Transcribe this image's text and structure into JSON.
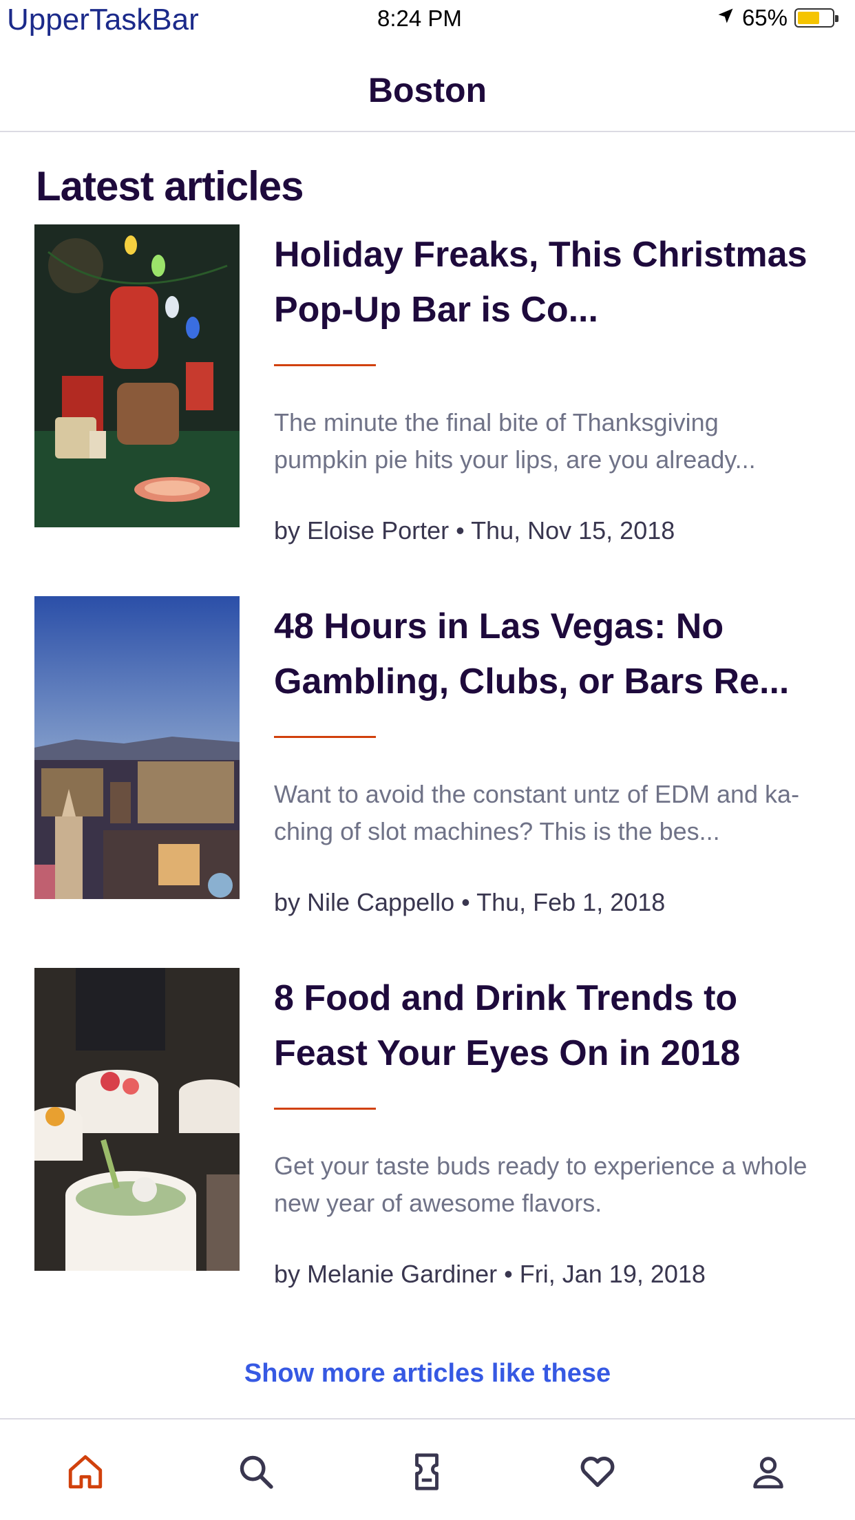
{
  "status_bar": {
    "carrier": "UpperTaskBar",
    "time": "8:24 PM",
    "battery": "65%",
    "battery_level": 0.65,
    "battery_color": "#f5c400"
  },
  "header": {
    "title": "Boston"
  },
  "section": {
    "title": "Latest articles"
  },
  "articles": [
    {
      "title": "Holiday Freaks, This Christmas Pop-Up Bar is Co...",
      "description": "The minute the final bite of Thanksgiving pumpkin pie hits your lips, are you already...",
      "meta": "by Eloise Porter • Thu, Nov 15, 2018",
      "image": "christmas-bar-photo"
    },
    {
      "title": "48 Hours in Las Vegas: No Gambling, Clubs, or Bars Re...",
      "description": "Want to avoid the constant untz of EDM and ka-ching of slot machines? This is the bes...",
      "meta": "by Nile Cappello • Thu, Feb 1, 2018",
      "image": "las-vegas-skyline-photo"
    },
    {
      "title": "8 Food and Drink Trends to Feast Your Eyes On in 2018",
      "description": "Get your taste buds ready to experience a whole new year of awesome flavors.",
      "meta": "by Melanie Gardiner • Fri, Jan 19, 2018",
      "image": "food-bowls-photo"
    }
  ],
  "show_more": "Show more articles like these",
  "bottom_nav": [
    {
      "icon": "home-icon",
      "active": true
    },
    {
      "icon": "search-icon",
      "active": false
    },
    {
      "icon": "ticket-icon",
      "active": false
    },
    {
      "icon": "heart-icon",
      "active": false
    },
    {
      "icon": "profile-icon",
      "active": false
    }
  ],
  "colors": {
    "accent": "#d1410c",
    "link": "#3659e3",
    "heading": "#1e0a3c",
    "body_text": "#6f7287",
    "nav_icon": "#39364f"
  }
}
